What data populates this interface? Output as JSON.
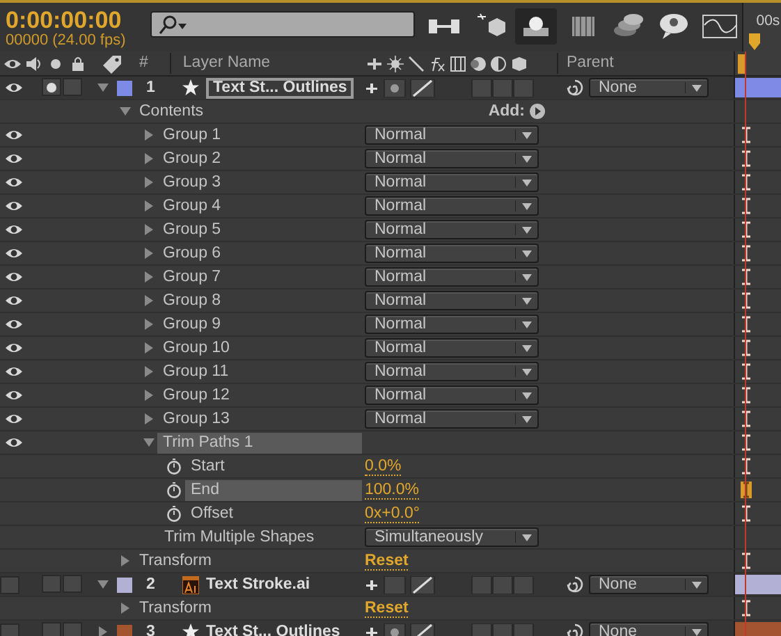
{
  "timecode": "0:00:00:00",
  "frame_count": "00000 (24.00 fps)",
  "toolbar": [
    {
      "pressed": false
    },
    {
      "pressed": false
    },
    {
      "pressed": true
    },
    {
      "pressed": false
    },
    {
      "pressed": false
    },
    {
      "pressed": false
    },
    {
      "pressed": false
    }
  ],
  "ruler_label": "00s",
  "columns": {
    "number": "#",
    "layer_name": "Layer Name",
    "parent": "Parent"
  },
  "layers": [
    {
      "number": "1",
      "name": "Text St... Outlines",
      "kind": "shape",
      "color": "#7d8ae6",
      "visible": true,
      "solo": true,
      "expanded": true,
      "selected": true,
      "parent": "None",
      "children": [
        {
          "kind": "section",
          "name": "Contents",
          "expanded": true,
          "add_label": "Add:",
          "children": [
            {
              "kind": "group",
              "name": "Group 1",
              "expanded": false,
              "visible": true,
              "mode": "Normal"
            },
            {
              "kind": "group",
              "name": "Group 2",
              "expanded": false,
              "visible": true,
              "mode": "Normal"
            },
            {
              "kind": "group",
              "name": "Group 3",
              "expanded": false,
              "visible": true,
              "mode": "Normal"
            },
            {
              "kind": "group",
              "name": "Group 4",
              "expanded": false,
              "visible": true,
              "mode": "Normal"
            },
            {
              "kind": "group",
              "name": "Group 5",
              "expanded": false,
              "visible": true,
              "mode": "Normal"
            },
            {
              "kind": "group",
              "name": "Group 6",
              "expanded": false,
              "visible": true,
              "mode": "Normal"
            },
            {
              "kind": "group",
              "name": "Group 7",
              "expanded": false,
              "visible": true,
              "mode": "Normal"
            },
            {
              "kind": "group",
              "name": "Group 8",
              "expanded": false,
              "visible": true,
              "mode": "Normal"
            },
            {
              "kind": "group",
              "name": "Group 9",
              "expanded": false,
              "visible": true,
              "mode": "Normal"
            },
            {
              "kind": "group",
              "name": "Group 10",
              "expanded": false,
              "visible": true,
              "mode": "Normal"
            },
            {
              "kind": "group",
              "name": "Group 11",
              "expanded": false,
              "visible": true,
              "mode": "Normal"
            },
            {
              "kind": "group",
              "name": "Group 12",
              "expanded": false,
              "visible": true,
              "mode": "Normal"
            },
            {
              "kind": "group",
              "name": "Group 13",
              "expanded": false,
              "visible": true,
              "mode": "Normal"
            },
            {
              "kind": "operator",
              "name": "Trim Paths 1",
              "expanded": true,
              "visible": true,
              "selected": true,
              "children": [
                {
                  "kind": "property",
                  "name": "Start",
                  "value": "0.0%",
                  "selected": false
                },
                {
                  "kind": "property",
                  "name": "End",
                  "value": "100.0%",
                  "selected": true
                },
                {
                  "kind": "property",
                  "name": "Offset",
                  "value": "0x+0.0°",
                  "selected": false
                },
                {
                  "kind": "choice",
                  "name": "Trim Multiple Shapes",
                  "value": "Simultaneously"
                }
              ]
            }
          ]
        },
        {
          "kind": "transform",
          "name": "Transform",
          "expanded": false,
          "value": "Reset"
        }
      ]
    },
    {
      "number": "2",
      "name": "Text Stroke.ai",
      "kind": "footage",
      "color": "#b3b0d6",
      "visible": false,
      "solo": false,
      "expanded": true,
      "selected": false,
      "parent": "None",
      "children": [
        {
          "kind": "transform",
          "name": "Transform",
          "expanded": false,
          "value": "Reset"
        }
      ]
    },
    {
      "number": "3",
      "name": "Text St... Outlines",
      "kind": "shape",
      "color": "#a4552f",
      "visible": false,
      "solo": false,
      "expanded": false,
      "selected": false,
      "parent": "None"
    }
  ]
}
